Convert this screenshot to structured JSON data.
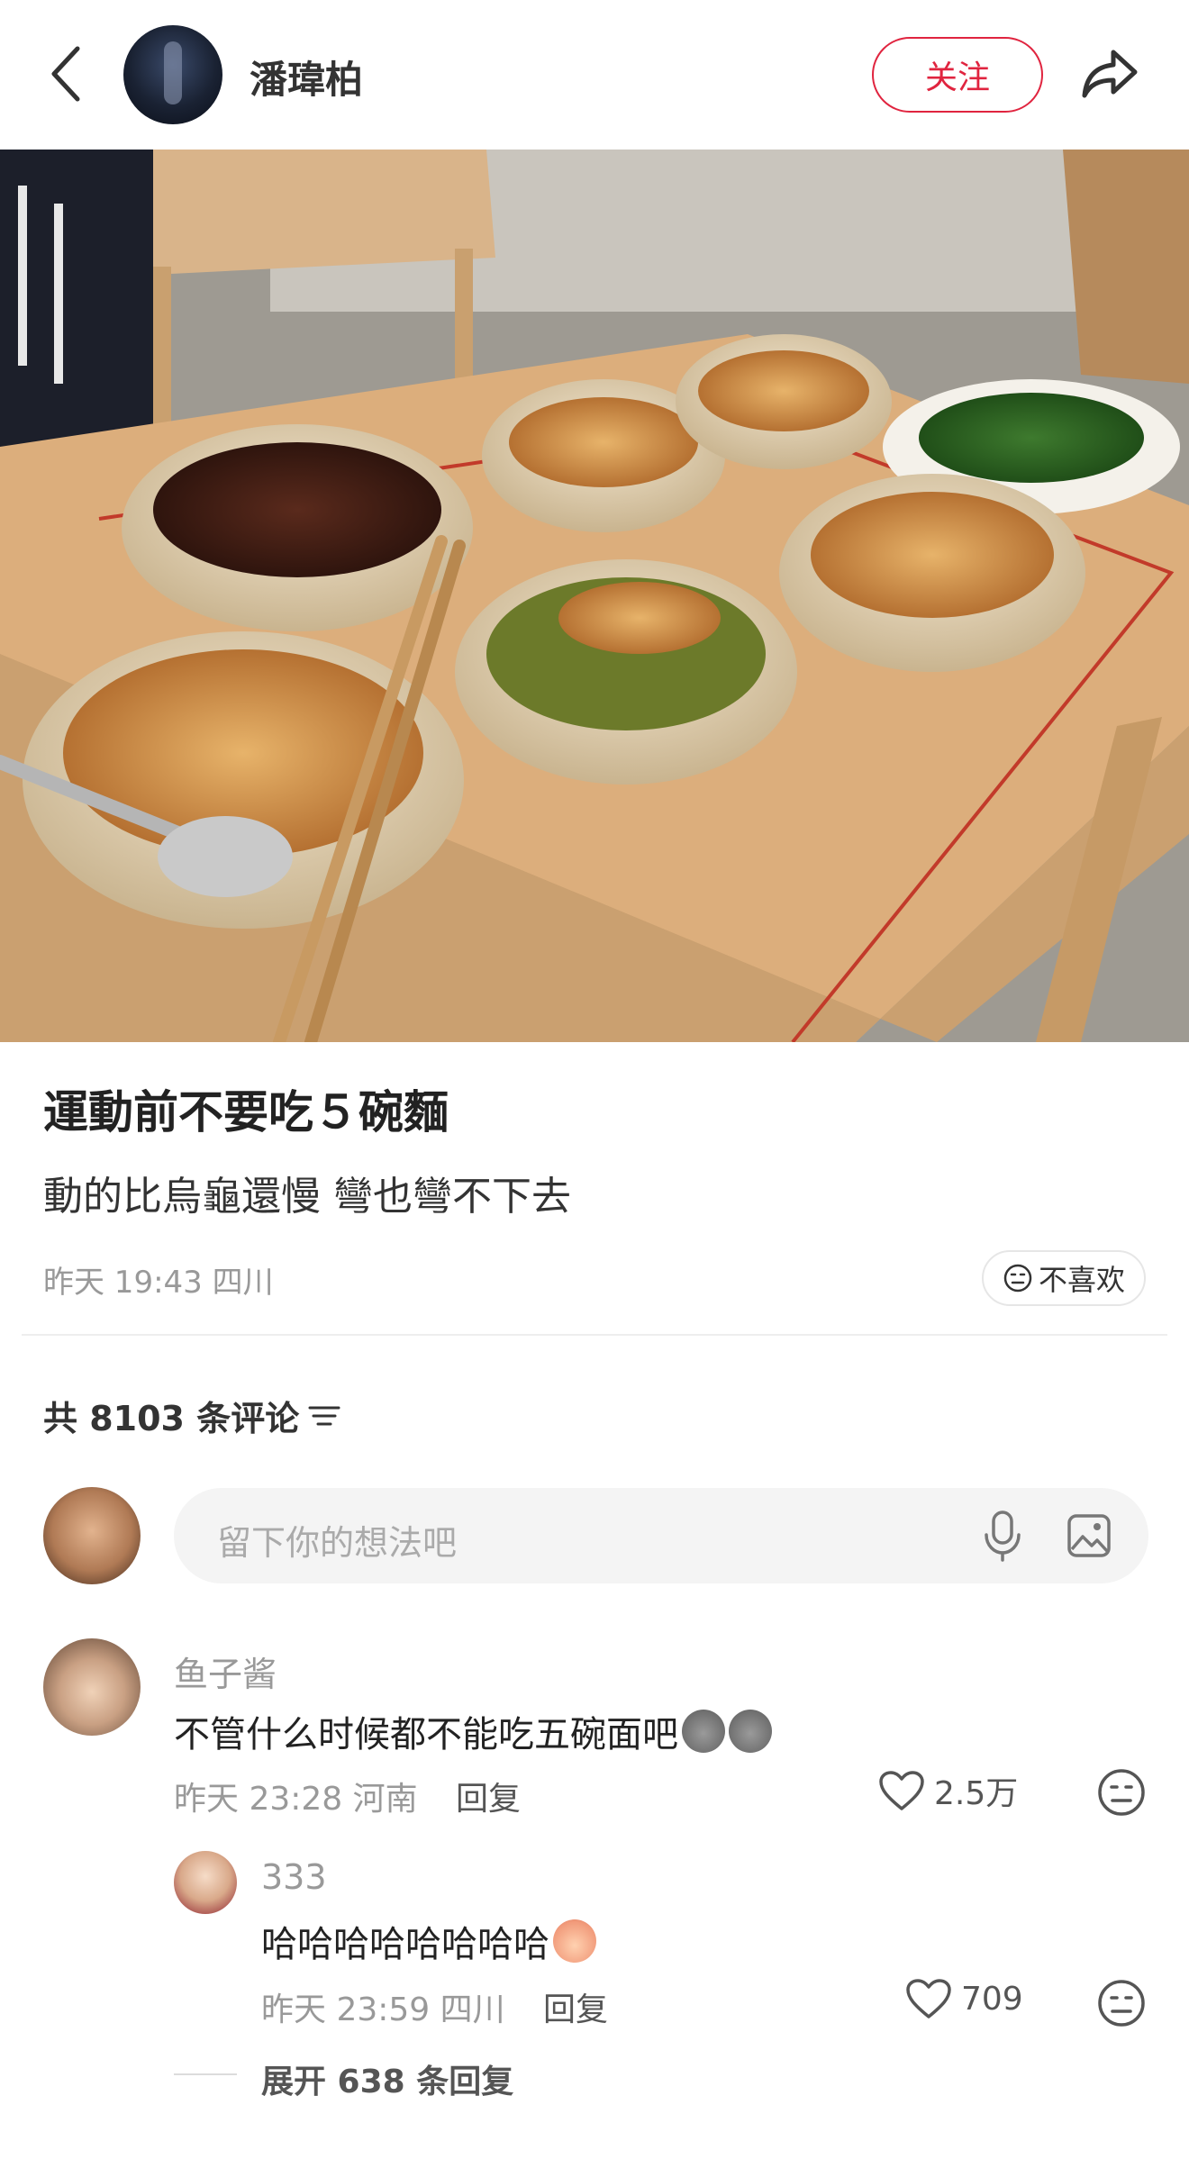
{
  "header": {
    "username": "潘瑋柏",
    "follow_label": "关注",
    "accent_color": "#e0243f"
  },
  "post": {
    "title": "運動前不要吃５碗麵",
    "description": "動的比烏龜還慢 彎也彎不下去",
    "meta": "昨天 19:43 四川",
    "dislike_label": "不喜欢"
  },
  "comments_section": {
    "count_label": "共 8103 条评论",
    "input_placeholder": "留下你的想法吧"
  },
  "comments": [
    {
      "name": "鱼子酱",
      "text": "不管什么时候都不能吃五碗面吧",
      "meta": "昨天 23:28 河南",
      "reply_label": "回复",
      "likes": "2.5万"
    }
  ],
  "replies": [
    {
      "name": "333",
      "text": "哈哈哈哈哈哈哈哈",
      "meta": "昨天 23:59 四川",
      "reply_label": "回复",
      "likes": "709"
    }
  ],
  "expand_label": "展开 638 条回复",
  "icons": [
    "back-icon",
    "share-icon",
    "dislike-face-icon",
    "sort-icon",
    "mic-icon",
    "image-icon",
    "heart-icon"
  ]
}
